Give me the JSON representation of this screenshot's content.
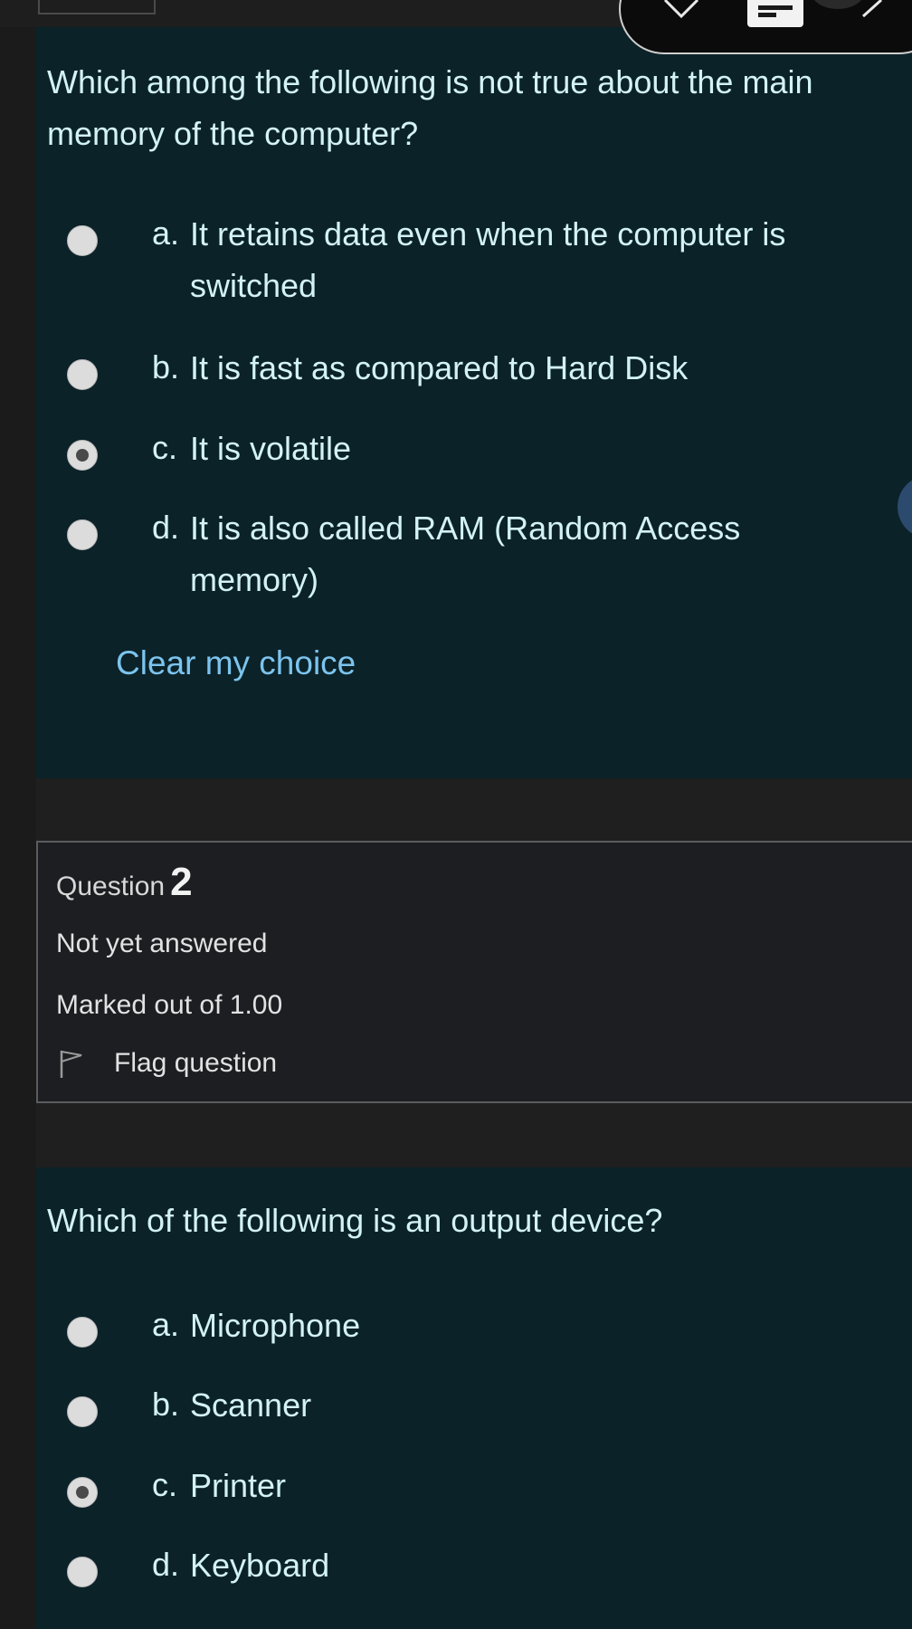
{
  "question1": {
    "text": "Which among the following is not true about the main memory of the computer?",
    "options": [
      {
        "letter": "a.",
        "text": "It retains data even when the computer is switched",
        "selected": false
      },
      {
        "letter": "b.",
        "text": "It is fast as compared to Hard Disk",
        "selected": false
      },
      {
        "letter": "c.",
        "text": "It is volatile",
        "selected": true
      },
      {
        "letter": "d.",
        "text": "It is also called RAM (Random Access memory)",
        "selected": false
      }
    ],
    "clear_label": "Clear my choice"
  },
  "question2_info": {
    "label": "Question",
    "number": "2",
    "status": "Not yet answered",
    "marks": "Marked out of 1.00",
    "flag_label": "Flag question"
  },
  "question2": {
    "text": "Which of the following is an output device?",
    "options": [
      {
        "letter": "a.",
        "text": "Microphone",
        "selected": false
      },
      {
        "letter": "b.",
        "text": "Scanner",
        "selected": false
      },
      {
        "letter": "c.",
        "text": "Printer",
        "selected": true
      },
      {
        "letter": "d.",
        "text": "Keyboard",
        "selected": false
      }
    ]
  },
  "colors": {
    "card_bg": "#0b2228",
    "text": "#d3f2f6",
    "link": "#7cc4ee",
    "info_bg": "#1c1e22"
  },
  "icons": [
    "close-icon",
    "document-icon",
    "chevron-right-icon",
    "flag-icon"
  ]
}
